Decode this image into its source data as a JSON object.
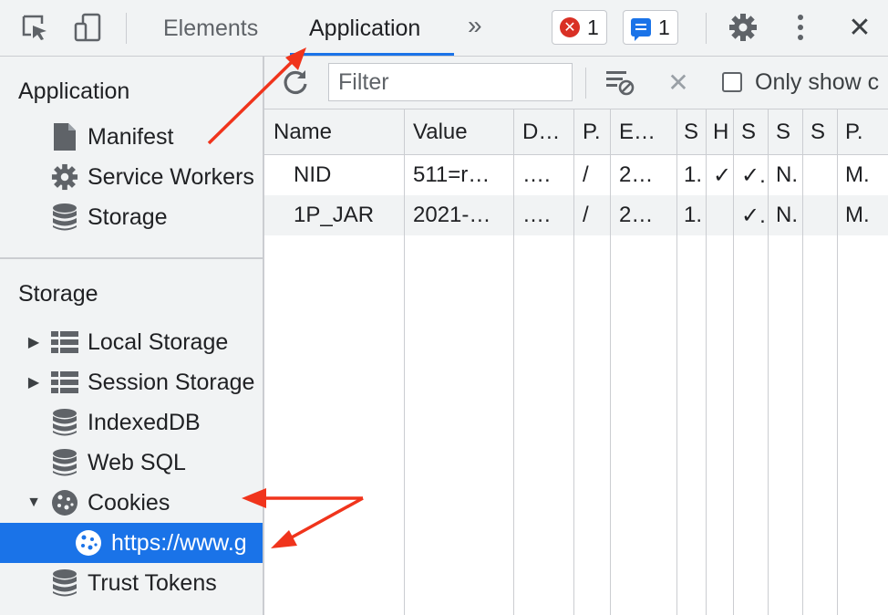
{
  "toolbar": {
    "tabs": [
      {
        "label": "Elements"
      },
      {
        "label": "Application"
      }
    ],
    "more_tabs": "»",
    "error_count": "1",
    "message_count": "1",
    "close": "✕"
  },
  "sidebar": {
    "application_heading": "Application",
    "application_items": [
      {
        "label": "Manifest",
        "icon": "document-icon"
      },
      {
        "label": "Service Workers",
        "icon": "gear-icon"
      },
      {
        "label": "Storage",
        "icon": "database-icon"
      }
    ],
    "storage_heading": "Storage",
    "storage_items": [
      {
        "label": "Local Storage",
        "icon": "grid-icon"
      },
      {
        "label": "Session Storage",
        "icon": "grid-icon"
      },
      {
        "label": "IndexedDB",
        "icon": "database-icon"
      },
      {
        "label": "Web SQL",
        "icon": "database-icon"
      },
      {
        "label": "Cookies",
        "icon": "cookie-icon"
      },
      {
        "label": "https://www.g",
        "icon": "cookie-icon"
      },
      {
        "label": "Trust Tokens",
        "icon": "database-icon"
      }
    ]
  },
  "filterbar": {
    "filter_placeholder": "Filter",
    "only_show_label": "Only show c"
  },
  "table": {
    "columns": [
      "Name",
      "Value",
      "D…",
      "P.",
      "E…",
      "S",
      "H",
      "S",
      "S",
      "S",
      "P."
    ],
    "rows": [
      [
        "NID",
        "511=r…",
        "….",
        "/",
        "2…",
        "1.",
        "✓",
        "✓.",
        "N.",
        "",
        "M."
      ],
      [
        "1P_JAR",
        "2021-…",
        "….",
        "/",
        "2…",
        "1.",
        "",
        "✓.",
        "N.",
        "",
        "M."
      ]
    ]
  },
  "colors": {
    "accent": "#1a73e8",
    "annotation_arrow": "#f0341c",
    "error": "#d93025"
  }
}
